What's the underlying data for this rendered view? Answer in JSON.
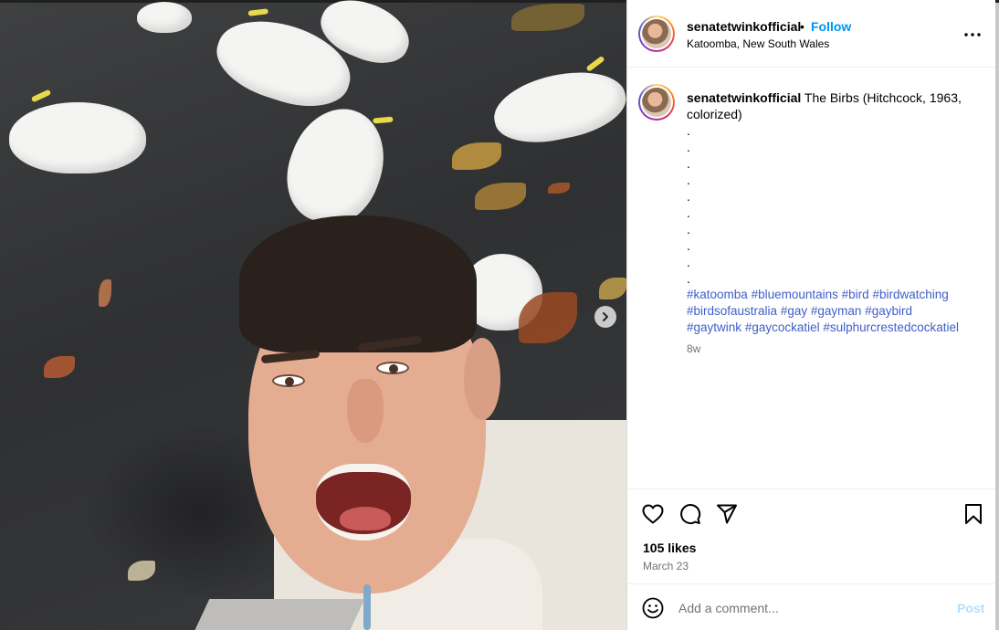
{
  "header": {
    "username": "senatetwinkofficial",
    "separator": "•",
    "follow_label": "Follow",
    "location": "Katoomba, New South Wales",
    "more_icon": "more-horizontal-icon"
  },
  "caption": {
    "username": "senatetwinkofficial",
    "text": "The Birbs (Hitchcock, 1963, colorized)",
    "dots": [
      ".",
      ".",
      ".",
      ".",
      ".",
      ".",
      ".",
      ".",
      ".",
      "."
    ],
    "hashtags": [
      "#katoomba",
      "#bluemountains",
      "#bird",
      "#birdwatching",
      "#birdsofaustralia",
      "#gay",
      "#gayman",
      "#gaybird",
      "#gaytwink",
      "#gaycockatiel",
      "#sulphurcrestedcockatiel"
    ],
    "time_ago": "8w"
  },
  "media": {
    "next_icon": "chevron-right-icon"
  },
  "actions": {
    "like_icon": "heart-icon",
    "comment_icon": "comment-icon",
    "share_icon": "send-icon",
    "save_icon": "bookmark-icon",
    "likes": "105 likes",
    "date": "March 23"
  },
  "comment": {
    "emoji_icon": "emoji-icon",
    "placeholder": "Add a comment...",
    "post_label": "Post"
  },
  "colors": {
    "follow": "#0095f6",
    "hashtag": "#3f5fc8",
    "post_disabled": "#b2dffc",
    "muted": "#737373"
  }
}
